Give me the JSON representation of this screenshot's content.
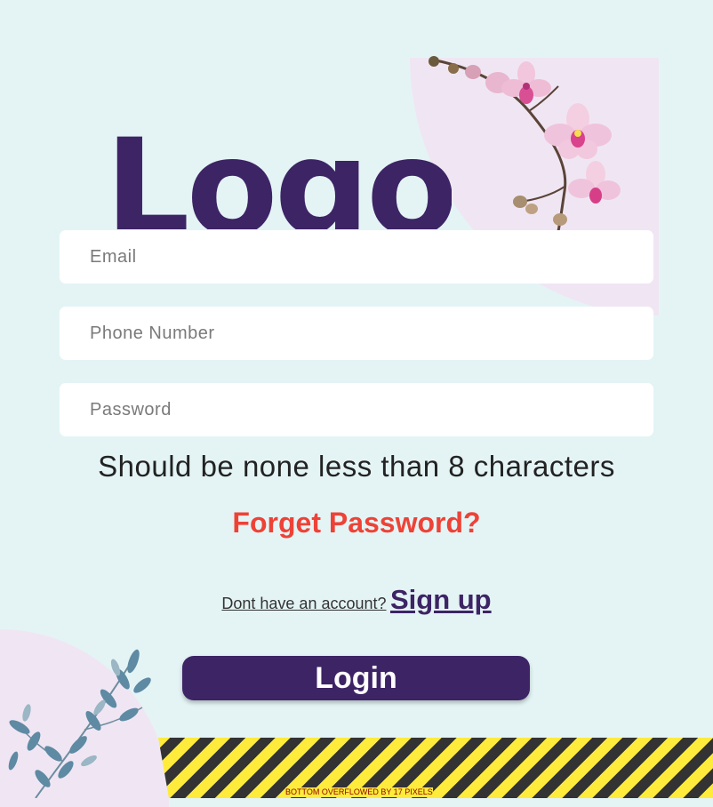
{
  "logo": {
    "text": "Logo"
  },
  "fields": {
    "email_placeholder": "Email",
    "phone_placeholder": "Phone Number",
    "password_placeholder": "Password"
  },
  "password_hint": "Should be none less than 8 characters",
  "forgot_password": "Forget Password?",
  "signup": {
    "question": "Dont have an account?",
    "link": "Sign up"
  },
  "login_button": "Login",
  "overflow_warning": "BOTTOM OVERFLOWED BY 17 PIXELS",
  "colors": {
    "background": "#e4f4f5",
    "accent_shape": "#f0e6f3",
    "brand": "#3d2465",
    "error": "#ee4237",
    "field_bg": "#ffffff"
  },
  "icons": [
    "orchid-flower-decoration",
    "leaf-branch-decoration"
  ]
}
